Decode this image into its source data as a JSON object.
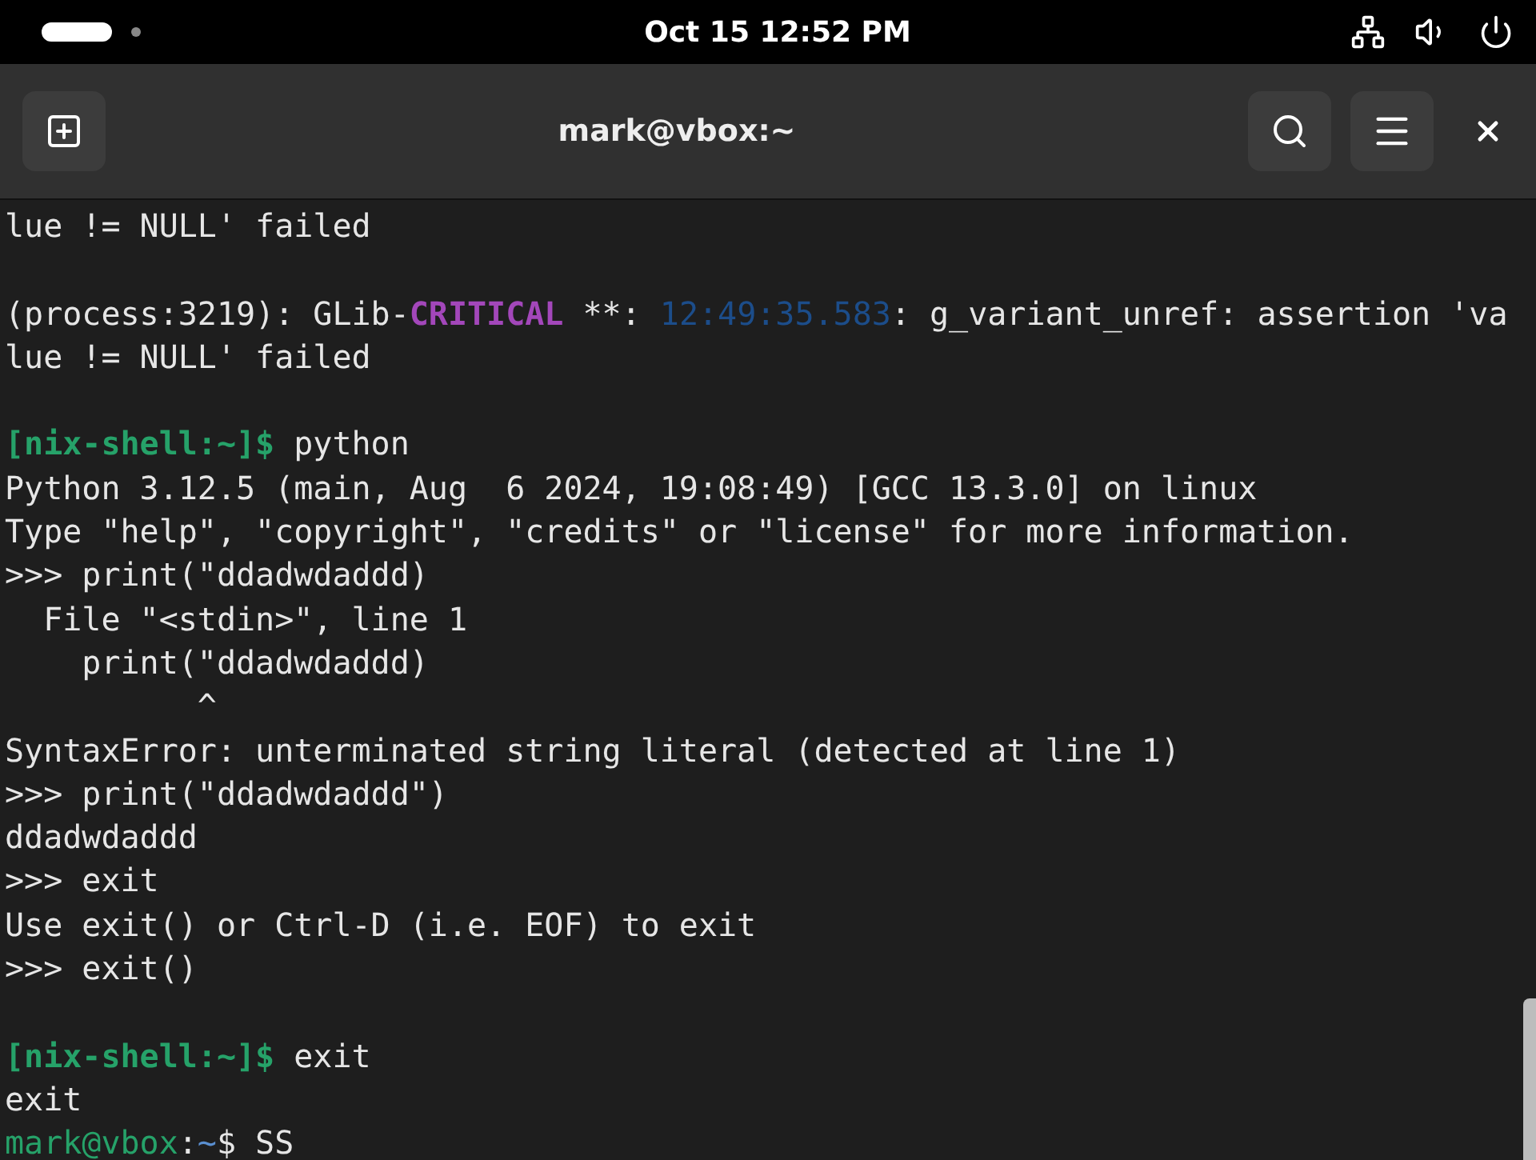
{
  "top_bar": {
    "clock": "Oct 15  12:52 PM"
  },
  "window": {
    "title": "mark@vbox:~"
  },
  "terminal": {
    "lines": [
      {
        "kind": "text",
        "segments": [
          {
            "kind": "plain",
            "text": "lue != NULL' failed"
          }
        ]
      },
      {
        "kind": "blank"
      },
      {
        "kind": "text",
        "segments": [
          {
            "kind": "plain",
            "text": "(process:3219): GLib-"
          },
          {
            "kind": "critical",
            "text": "CRITICAL"
          },
          {
            "kind": "plain",
            "text": " **: "
          },
          {
            "kind": "timestamp",
            "text": "12:49:35.583"
          },
          {
            "kind": "plain",
            "text": ": g_variant_unref: assertion 'va"
          }
        ]
      },
      {
        "kind": "text",
        "segments": [
          {
            "kind": "plain",
            "text": "lue != NULL' failed"
          }
        ]
      },
      {
        "kind": "blank"
      },
      {
        "kind": "text",
        "segments": [
          {
            "kind": "prompt",
            "text": "[nix-shell:~]$"
          },
          {
            "kind": "plain",
            "text": " python"
          }
        ]
      },
      {
        "kind": "text",
        "segments": [
          {
            "kind": "plain",
            "text": "Python 3.12.5 (main, Aug  6 2024, 19:08:49) [GCC 13.3.0] on linux"
          }
        ]
      },
      {
        "kind": "text",
        "segments": [
          {
            "kind": "plain",
            "text": "Type \"help\", \"copyright\", \"credits\" or \"license\" for more information."
          }
        ]
      },
      {
        "kind": "text",
        "segments": [
          {
            "kind": "plain",
            "text": ">>> print(\"ddadwdaddd)"
          }
        ]
      },
      {
        "kind": "text",
        "segments": [
          {
            "kind": "plain",
            "text": "  File \"<stdin>\", line 1"
          }
        ]
      },
      {
        "kind": "text",
        "segments": [
          {
            "kind": "plain",
            "text": "    print(\"ddadwdaddd)"
          }
        ]
      },
      {
        "kind": "text",
        "segments": [
          {
            "kind": "plain",
            "text": "          ^"
          }
        ]
      },
      {
        "kind": "text",
        "segments": [
          {
            "kind": "plain",
            "text": "SyntaxError: unterminated string literal (detected at line 1)"
          }
        ]
      },
      {
        "kind": "text",
        "segments": [
          {
            "kind": "plain",
            "text": ">>> print(\"ddadwdaddd\")"
          }
        ]
      },
      {
        "kind": "text",
        "segments": [
          {
            "kind": "plain",
            "text": "ddadwdaddd"
          }
        ]
      },
      {
        "kind": "text",
        "segments": [
          {
            "kind": "plain",
            "text": ">>> exit"
          }
        ]
      },
      {
        "kind": "text",
        "segments": [
          {
            "kind": "plain",
            "text": "Use exit() or Ctrl-D (i.e. EOF) to exit"
          }
        ]
      },
      {
        "kind": "text",
        "segments": [
          {
            "kind": "plain",
            "text": ">>> exit()"
          }
        ]
      },
      {
        "kind": "blank"
      },
      {
        "kind": "text",
        "segments": [
          {
            "kind": "prompt",
            "text": "[nix-shell:~]$"
          },
          {
            "kind": "plain",
            "text": " exit"
          }
        ]
      },
      {
        "kind": "text",
        "segments": [
          {
            "kind": "plain",
            "text": "exit"
          }
        ]
      },
      {
        "kind": "text",
        "segments": [
          {
            "kind": "host",
            "text": "mark@vbox"
          },
          {
            "kind": "plain",
            "text": ":"
          },
          {
            "kind": "path",
            "text": "~"
          },
          {
            "kind": "plain",
            "text": "$ SS"
          }
        ]
      }
    ]
  }
}
